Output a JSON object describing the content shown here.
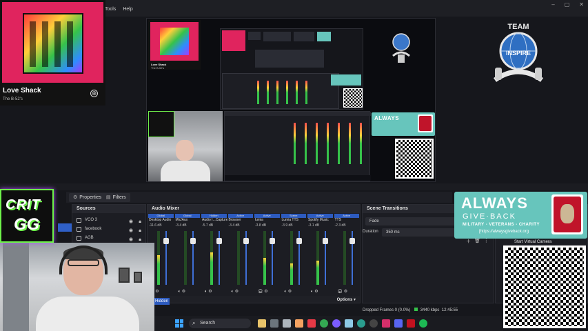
{
  "menu": {
    "items": [
      "Tools",
      "Help"
    ]
  },
  "window_controls": [
    "–",
    "▢",
    "✕"
  ],
  "spotify": {
    "song": "Love Shack",
    "artist": "The B-52's",
    "add_glyph": "⊕"
  },
  "preview_spotify": {
    "song": "Love Shack",
    "artist": "The B-52's"
  },
  "tabs": {
    "properties": "Properties",
    "filters": "Filters"
  },
  "sources": {
    "title": "Sources",
    "items": [
      {
        "label": "VCO 3"
      },
      {
        "label": "facebook"
      },
      {
        "label": "AGB"
      }
    ]
  },
  "mixer": {
    "title": "Audio Mixer",
    "tab_labels": [
      "Global",
      "Global",
      "Hidden",
      "Active",
      "Active",
      "Scene",
      "Active",
      "Active"
    ],
    "channels": [
      {
        "name": "Desktop Audio",
        "db": "-11.6 dB",
        "level": 0.55
      },
      {
        "name": "Mic/Aux",
        "db": "-3.4 dB",
        "level": 0.0
      },
      {
        "name": "Audio I...Capture",
        "db": "-5.7 dB",
        "level": 0.6
      },
      {
        "name": "Browser",
        "db": "-3.4 dB",
        "level": 0.0
      },
      {
        "name": "lumia",
        "db": "-3.8 dB",
        "level": 0.5
      },
      {
        "name": "Lumia TTS",
        "db": "-3.9 dB",
        "level": 0.4
      },
      {
        "name": "Spotify Music",
        "db": "-3.1 dB",
        "level": 0.45
      },
      {
        "name": "TTS",
        "db": "-2.3 dB",
        "level": 0.0
      }
    ],
    "options_label": "Options",
    "hidden_label": "Hidden"
  },
  "transitions": {
    "title": "Scene Transitions",
    "type": "Fade",
    "duration_label": "Duration",
    "duration_value": "350 ms"
  },
  "controls": {
    "start_virtual_camera": "Start Virtual Camera"
  },
  "always_give_back": {
    "line1": "ALWAYS",
    "line2": "GIVE·BACK",
    "line3": "MILITARY - VETERANS - CHARITY",
    "line4": "[https://alwaysgiveback.org"
  },
  "crit_logo": {
    "line1": "CRIT",
    "line2": "GG"
  },
  "team_logo": {
    "line1": "TEAM",
    "line2": "INSPIRE"
  },
  "status": {
    "dropped": "Dropped Frames 0 (0.0%)",
    "kbps": "3440 kbps",
    "time": "12:45:55"
  },
  "taskbar": {
    "search": "Search"
  },
  "colors": {
    "accent_blue": "#2d5bbf",
    "crit_green": "#6ef34a",
    "agb_teal": "#67c5bc",
    "spotify_pink": "#e0245e"
  }
}
